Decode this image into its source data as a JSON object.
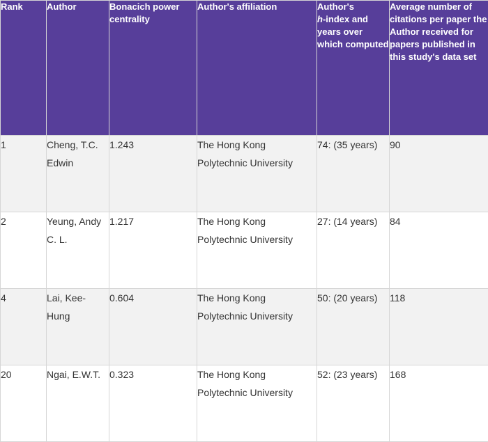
{
  "table": {
    "headers": {
      "rank": "Rank",
      "author": "Author",
      "bonacich": "Bonacich power centrality",
      "affiliation": "Author's affiliation",
      "hindex_prefix": "Author's",
      "hindex_italic": "h",
      "hindex_suffix": "-index and years over which computed",
      "citations": "Average number of citations per paper the Author received for papers published in this study's data set"
    },
    "rows": [
      {
        "rank": "1",
        "author": "Cheng, T.C. Edwin",
        "bonacich": "1.243",
        "affiliation": "The Hong Kong Polytechnic University",
        "hindex": "74: (35 years)",
        "citations": "90"
      },
      {
        "rank": "2",
        "author": "Yeung, Andy C. L.",
        "bonacich": "1.217",
        "affiliation": "The Hong Kong Polytechnic University",
        "hindex": "27: (14 years)",
        "citations": "84"
      },
      {
        "rank": "4",
        "author": "Lai, Kee-Hung",
        "bonacich": "0.604",
        "affiliation": "The Hong Kong Polytechnic University",
        "hindex": "50: (20 years)",
        "citations": "118"
      },
      {
        "rank": "20",
        "author": "Ngai, E.W.T.",
        "bonacich": "0.323",
        "affiliation": "The Hong Kong Polytechnic University",
        "hindex": "52: (23 years)",
        "citations": "168"
      }
    ]
  }
}
